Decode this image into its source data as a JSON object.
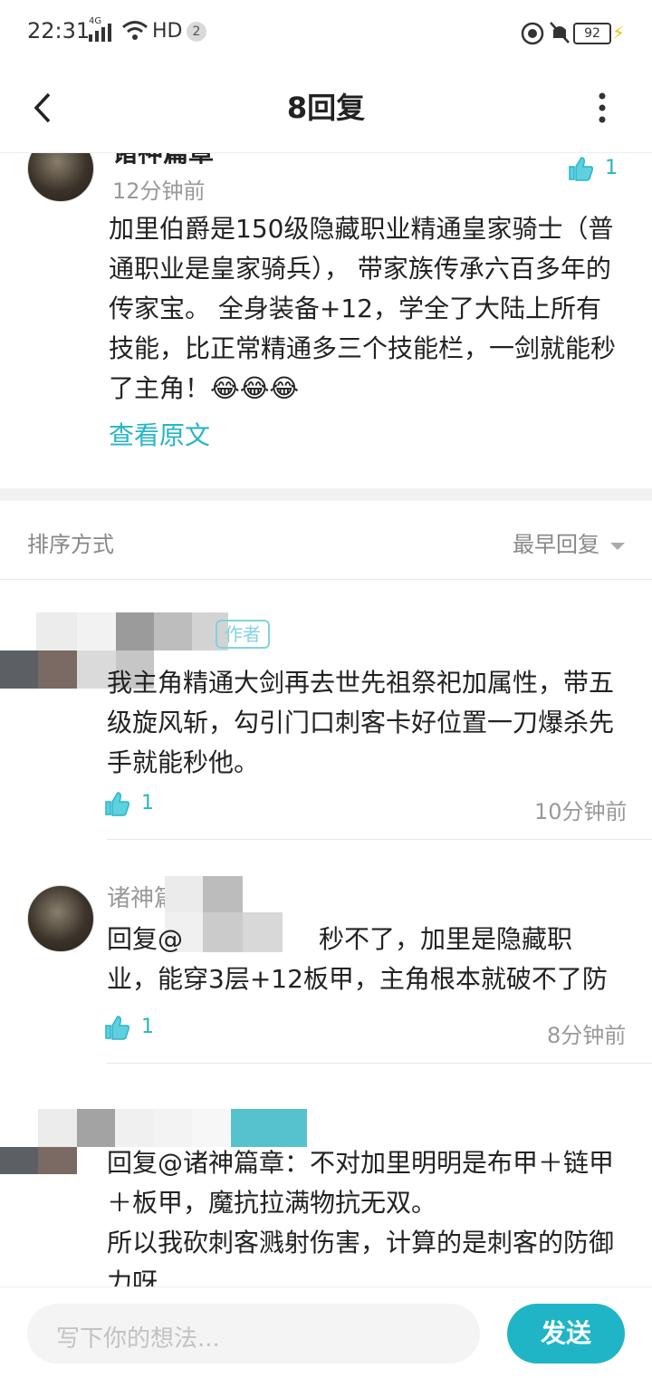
{
  "status_bar": {
    "time": "22:31",
    "network": "4G",
    "hd": "HD",
    "badge": "2",
    "battery": "92"
  },
  "header": {
    "title": "8回复"
  },
  "original_post": {
    "author": "诸神篇章",
    "time": "12分钟前",
    "likes": "1",
    "content": "加里伯爵是150级隐藏职业精通皇家骑士（普通职业是皇家骑兵）， 带家族传承六百多年的传家宝。 全身装备+12，学全了大陆上所有技能，比正常精通多三个技能栏，一剑就能秒了主角！😂😂😂",
    "view_original": "查看原文"
  },
  "sort": {
    "label": "排序方式",
    "value": "最早回复"
  },
  "replies": [
    {
      "tag": "作者",
      "content": "我主角精通大剑再去世先祖祭祀加属性，带五级旋风斩，勾引门口刺客卡好位置一刀爆杀先手就能秒他。",
      "likes": "1",
      "time": "10分钟前"
    },
    {
      "author": "诸神篇",
      "reply_prefix": "回复@",
      "content": "秒不了，加里是隐藏职业，能穿3层+12板甲，主角根本就破不了防",
      "likes": "1",
      "time": "8分钟前"
    },
    {
      "content": "回复@诸神篇章：不对加里明明是布甲＋链甲＋板甲，魔抗拉满物抗无双。",
      "content2": "所以我砍刺客溅射伤害，计算的是刺客的防御力呀"
    }
  ],
  "composer": {
    "placeholder": "写下你的想法...",
    "send": "发送"
  },
  "colors": {
    "accent": "#1fb5c6",
    "teal_text": "#26b5c8"
  }
}
